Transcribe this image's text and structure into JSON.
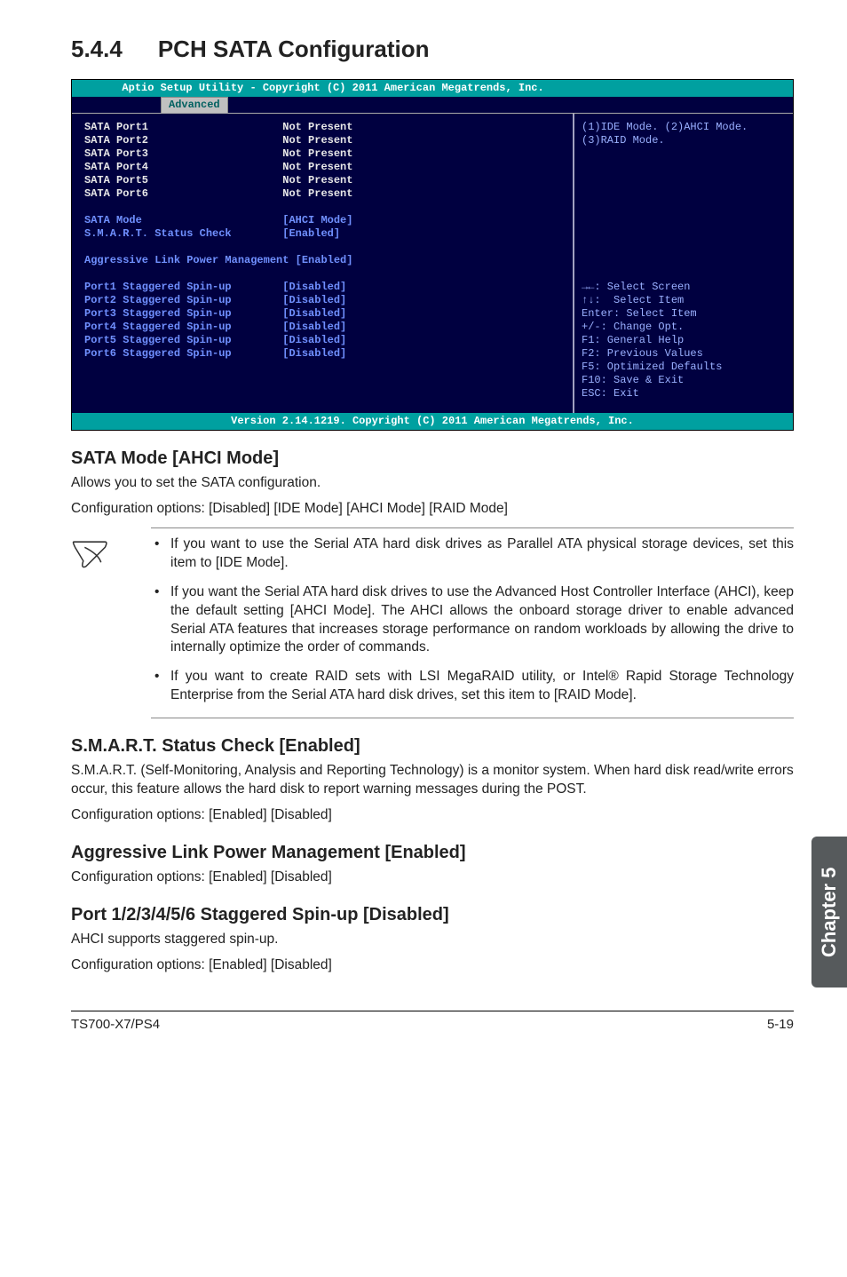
{
  "header": {
    "section_number": "5.4.4",
    "section_title": "PCH SATA Configuration"
  },
  "bios": {
    "title_bar": "Aptio Setup Utility - Copyright (C) 2011 American Megatrends, Inc.",
    "tab_label": "Advanced",
    "ports": [
      {
        "name": "SATA Port1",
        "status": "Not Present"
      },
      {
        "name": "SATA Port2",
        "status": "Not Present"
      },
      {
        "name": "SATA Port3",
        "status": "Not Present"
      },
      {
        "name": "SATA Port4",
        "status": "Not Present"
      },
      {
        "name": "SATA Port5",
        "status": "Not Present"
      },
      {
        "name": "SATA Port6",
        "status": "Not Present"
      }
    ],
    "sata_mode_label": "SATA Mode",
    "sata_mode_value": "[AHCI Mode]",
    "smart_label": "S.M.A.R.T. Status Check",
    "smart_value": "[Enabled]",
    "aggr_label": "Aggressive Link Power Management [Enabled]",
    "spinups": [
      {
        "name": "Port1 Staggered Spin-up",
        "value": "[Disabled]"
      },
      {
        "name": "Port2 Staggered Spin-up",
        "value": "[Disabled]"
      },
      {
        "name": "Port3 Staggered Spin-up",
        "value": "[Disabled]"
      },
      {
        "name": "Port4 Staggered Spin-up",
        "value": "[Disabled]"
      },
      {
        "name": "Port5 Staggered Spin-up",
        "value": "[Disabled]"
      },
      {
        "name": "Port6 Staggered Spin-up",
        "value": "[Disabled]"
      }
    ],
    "help_top": "(1)IDE Mode. (2)AHCI Mode.\n(3)RAID Mode.",
    "help_keys": "→←: Select Screen\n↑↓:  Select Item\nEnter: Select Item\n+/-: Change Opt.\nF1: General Help\nF2: Previous Values\nF5: Optimized Defaults\nF10: Save & Exit\nESC: Exit",
    "footer_bar": "Version 2.14.1219. Copyright (C) 2011 American Megatrends, Inc."
  },
  "sections": {
    "s1_title": "SATA Mode [AHCI Mode]",
    "s1_p1": "Allows you to set the SATA configuration.",
    "s1_p2": "Configuration options: [Disabled] [IDE Mode] [AHCI Mode] [RAID Mode]",
    "note1": "If you want to use the Serial ATA hard disk drives as Parallel ATA physical storage devices, set this item to [IDE Mode].",
    "note2": "If you want the Serial ATA hard disk drives to use the Advanced Host Controller Interface (AHCI), keep the default setting [AHCI Mode]. The AHCI allows the onboard storage driver to enable advanced Serial ATA features that increases storage performance on random workloads by allowing the drive to internally optimize the order of commands.",
    "note3": "If you want to create RAID sets with LSI MegaRAID utility, or Intel® Rapid Storage Technology Enterprise from the Serial ATA hard disk drives, set this item to [RAID Mode].",
    "s2_title": "S.M.A.R.T. Status Check [Enabled]",
    "s2_p1": "S.M.A.R.T. (Self-Monitoring, Analysis and Reporting Technology) is a monitor system. When hard disk read/write errors occur, this feature allows the hard disk to report warning messages during the POST.",
    "s2_p2": "Configuration options: [Enabled] [Disabled]",
    "s3_title": "Aggressive Link Power Management [Enabled]",
    "s3_p1": "Configuration options: [Enabled] [Disabled]",
    "s4_title": "Port 1/2/3/4/5/6 Staggered Spin-up [Disabled]",
    "s4_p1": "AHCI supports staggered spin-up.",
    "s4_p2": "Configuration options: [Enabled] [Disabled]"
  },
  "footer": {
    "left": "TS700-X7/PS4",
    "right": "5-19"
  },
  "chapter_tab": "Chapter 5"
}
